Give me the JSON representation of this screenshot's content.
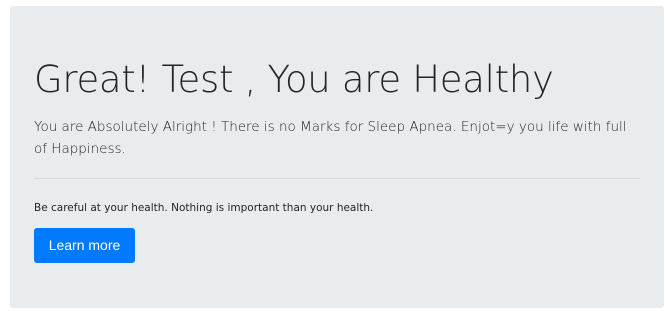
{
  "jumbotron": {
    "title": "Great! Test , You are Healthy",
    "lead": "You are Absolutely Alright ! There is no Marks for Sleep Apnea. Enjot=y you life with full of Happiness.",
    "note": "Be careful at your health. Nothing is important than your health.",
    "button_label": "Learn more"
  },
  "colors": {
    "background": "#e9ecef",
    "primary": "#007bff",
    "text": "#212529"
  }
}
